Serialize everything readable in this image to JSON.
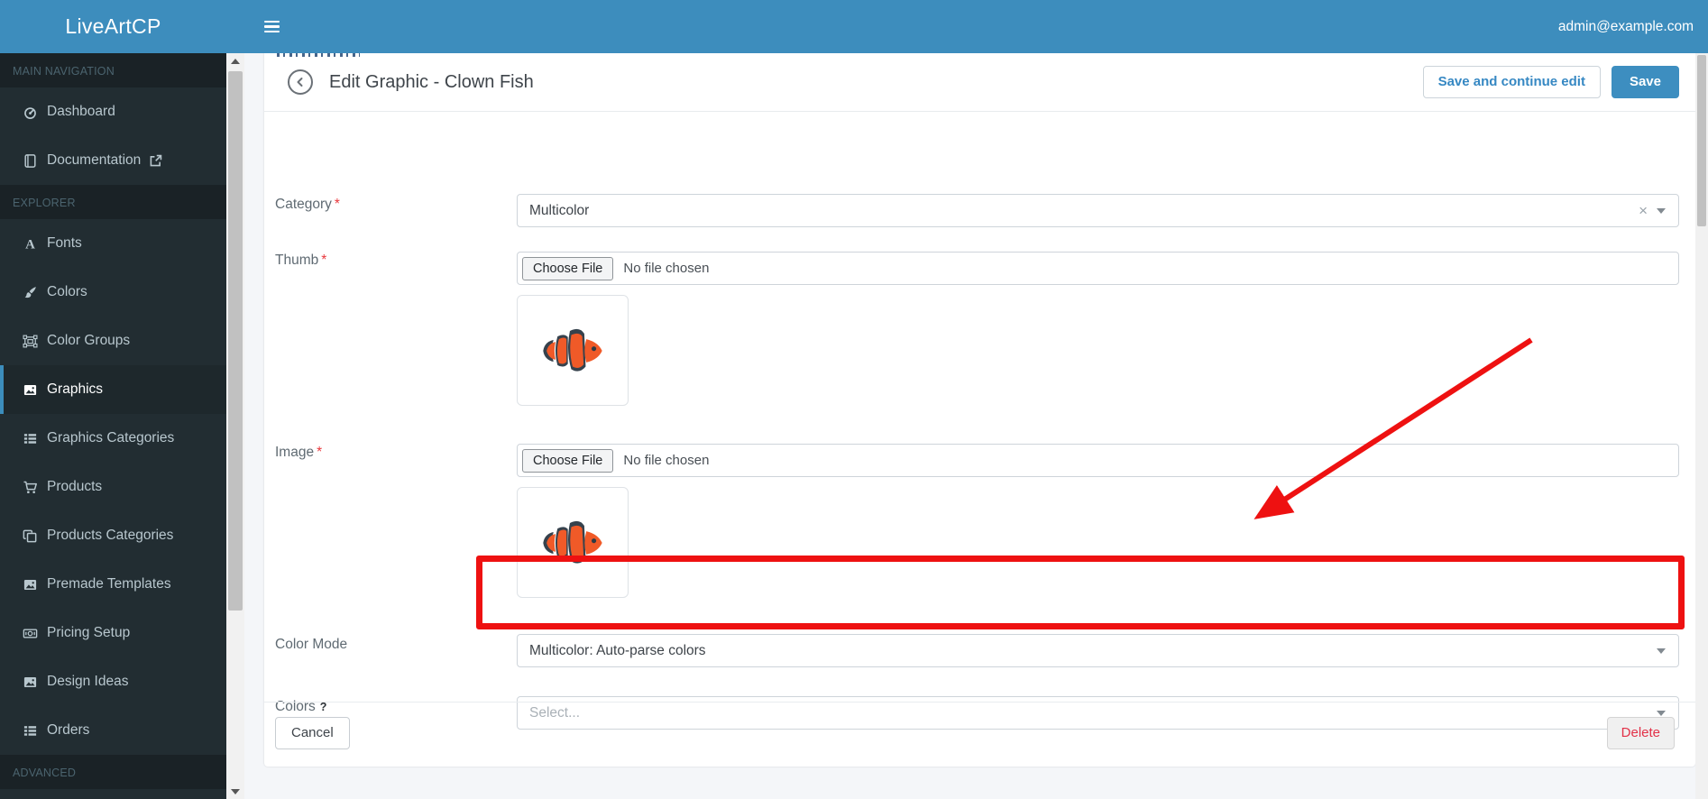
{
  "topbar": {
    "brand": "LiveArtCP",
    "user_email": "admin@example.com"
  },
  "sidebar": {
    "sections": [
      {
        "label": "MAIN NAVIGATION",
        "items": [
          {
            "icon": "gauge-icon",
            "label": "Dashboard"
          },
          {
            "icon": "book-icon",
            "label": "Documentation",
            "external": true
          }
        ]
      },
      {
        "label": "EXPLORER",
        "items": [
          {
            "icon": "font-icon",
            "label": "Fonts"
          },
          {
            "icon": "brush-icon",
            "label": "Colors"
          },
          {
            "icon": "object-group-icon",
            "label": "Color Groups"
          },
          {
            "icon": "image-icon",
            "label": "Graphics",
            "active": true
          },
          {
            "icon": "list-icon",
            "label": "Graphics Categories"
          },
          {
            "icon": "cart-icon",
            "label": "Products"
          },
          {
            "icon": "copy-icon",
            "label": "Products Categories"
          },
          {
            "icon": "image-icon",
            "label": "Premade Templates"
          },
          {
            "icon": "money-icon",
            "label": "Pricing Setup"
          },
          {
            "icon": "image-icon",
            "label": "Design Ideas"
          },
          {
            "icon": "list-icon",
            "label": "Orders"
          }
        ]
      },
      {
        "label": "ADVANCED",
        "items": []
      }
    ]
  },
  "header": {
    "title": "Edit Graphic - Clown Fish",
    "save_continue_label": "Save and continue edit",
    "save_label": "Save"
  },
  "form": {
    "fields": [
      {
        "id": "category",
        "type": "select",
        "label": "Category",
        "required": true,
        "value": "Multicolor",
        "clearable": true
      },
      {
        "id": "thumb",
        "type": "file",
        "label": "Thumb",
        "required": true,
        "button_label": "Choose File",
        "status": "No file chosen",
        "preview_icon": "clownfish-image"
      },
      {
        "id": "image",
        "type": "file",
        "label": "Image",
        "required": true,
        "button_label": "Choose File",
        "status": "No file chosen",
        "preview_icon": "clownfish-image"
      },
      {
        "id": "color_mode",
        "type": "select",
        "label": "Color Mode",
        "value": "Multicolor: Auto-parse colors"
      },
      {
        "id": "colors",
        "type": "select",
        "label": "Colors",
        "help": true,
        "placeholder": "Select..."
      }
    ],
    "cancel_label": "Cancel",
    "delete_label": "Delete"
  },
  "annotations": {
    "highlight_target": "color-mode-select",
    "arrow_direction": "points down-left at color mode field"
  },
  "colors": {
    "topbar_blue": "#3d8dbd",
    "sidebar_dark": "#222d32",
    "sidebar_section_bg": "#1a2226",
    "sidebar_text": "#b8c7ce",
    "active_accent": "#3c8dbc",
    "annotation_red": "#ee1111",
    "delete_red": "#e23148",
    "save_blue": "#3d8ec0",
    "fish_orange": "#f05a28",
    "fish_dark": "#36424d"
  }
}
